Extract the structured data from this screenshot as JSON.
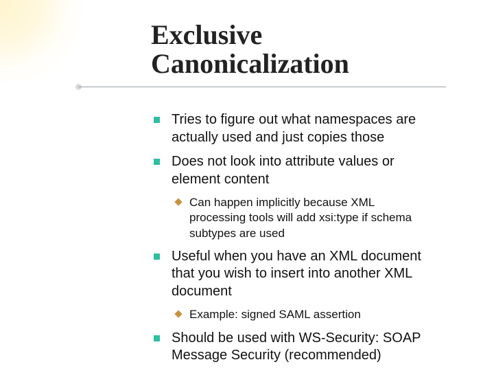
{
  "title_line1": "Exclusive",
  "title_line2": "Canonicalization",
  "bullets": {
    "b1": "Tries to figure out what namespaces are actually used and just copies those",
    "b2": "Does not look into attribute values or element content",
    "b2_sub1": "Can happen implicitly because XML processing tools will add xsi:type if schema subtypes are used",
    "b3": "Useful when you have an XML document that you wish to insert into another XML document",
    "b3_sub1": "Example: signed SAML assertion",
    "b4": "Should be used with WS-Security: SOAP Message Security (recommended)"
  }
}
